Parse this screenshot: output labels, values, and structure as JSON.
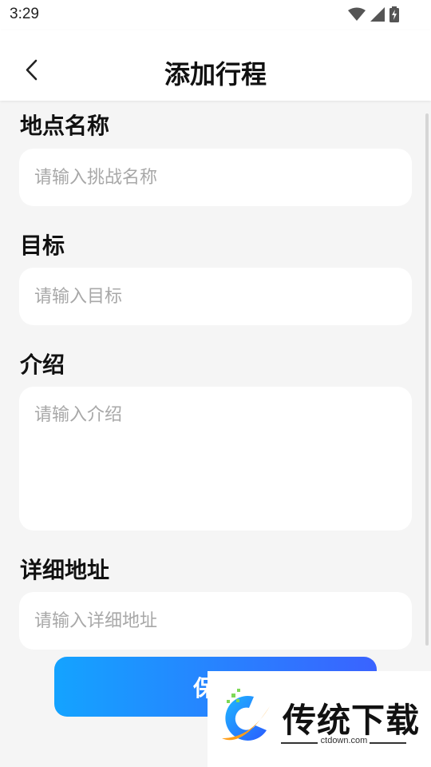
{
  "status_bar": {
    "time": "3:29",
    "icons": [
      "wifi-icon",
      "signal-icon",
      "battery-icon"
    ]
  },
  "header": {
    "title": "添加行程",
    "back_icon": "chevron-left-icon"
  },
  "form": {
    "place_name": {
      "label": "地点名称",
      "placeholder": "请输入挑战名称",
      "value": ""
    },
    "goal": {
      "label": "目标",
      "placeholder": "请输入目标",
      "value": ""
    },
    "intro": {
      "label": "介绍",
      "placeholder": "请输入介绍",
      "value": ""
    },
    "address": {
      "label": "详细地址",
      "placeholder": "请输入详细地址",
      "value": ""
    }
  },
  "save_button": {
    "label": "保存"
  },
  "watermark": {
    "name": "传统下载",
    "url": "ctdown.com"
  },
  "colors": {
    "accent_start": "#14a3ff",
    "accent_end": "#3a63ff",
    "background": "#f5f5f5",
    "field": "#ffffff"
  }
}
